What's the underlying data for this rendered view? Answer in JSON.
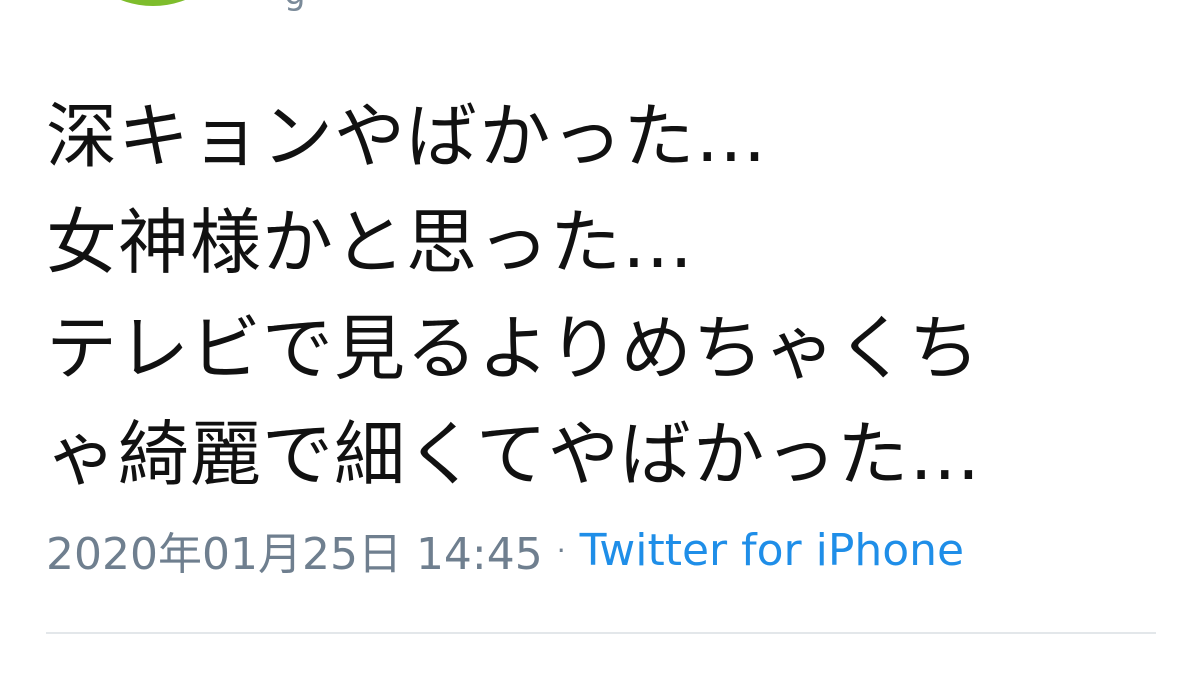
{
  "tweet": {
    "text_lines": [
      "深キョンやばかった…",
      "女神様かと思った…",
      "テレビで見るよりめちゃくち",
      "ゃ綺麗で細くてやばかった…"
    ],
    "timestamp": "2020年01月25日 14:45",
    "separator": "·",
    "source": "Twitter for iPhone"
  },
  "colors": {
    "avatar": "#7ebd2c",
    "text": "#111111",
    "meta": "#6f7f8f",
    "source": "#1f8ee8",
    "divider": "#e3e7ea"
  },
  "icons": {
    "avatar": "user-avatar"
  }
}
